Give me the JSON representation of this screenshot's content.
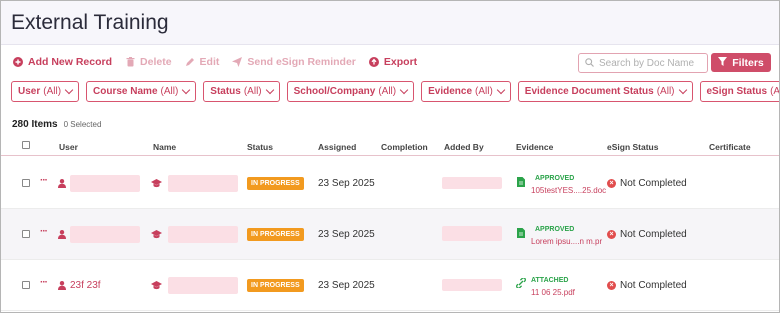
{
  "page": {
    "title": "External Training"
  },
  "toolbar": {
    "add_label": "Add New Record",
    "delete_label": "Delete",
    "edit_label": "Edit",
    "esign_label": "Send eSign Reminder",
    "export_label": "Export"
  },
  "search": {
    "placeholder": "Search by Doc Name"
  },
  "filters_button": {
    "label": "Filters"
  },
  "filter_chips": [
    {
      "label": "User",
      "value": "(All)"
    },
    {
      "label": "Course Name",
      "value": "(All)"
    },
    {
      "label": "Status",
      "value": "(All)"
    },
    {
      "label": "School/Company",
      "value": "(All)"
    },
    {
      "label": "Evidence",
      "value": "(All)"
    },
    {
      "label": "Evidence Document Status",
      "value": "(All)"
    },
    {
      "label": "eSign Status",
      "value": "(All)"
    }
  ],
  "summary": {
    "items": "280 Items",
    "selected": "0 Selected"
  },
  "table": {
    "columns": {
      "user": "User",
      "name": "Name",
      "status": "Status",
      "assigned": "Assigned",
      "completion": "Completion",
      "added_by": "Added By",
      "evidence": "Evidence",
      "esign_status": "eSign Status",
      "certificate": "Certificate"
    },
    "rows": [
      {
        "user": "",
        "status": "IN PROGRESS",
        "assigned": "23 Sep 2025",
        "evidence_label": "APPROVED",
        "evidence_file": "105testYES....25.doc",
        "esign": "Not Completed"
      },
      {
        "user": "",
        "status": "IN PROGRESS",
        "assigned": "23 Sep 2025",
        "evidence_label": "APPROVED",
        "evidence_file": "Lorem ipsu....n m.pr",
        "esign": "Not Completed"
      },
      {
        "user": "23f 23f",
        "status": "IN PROGRESS",
        "assigned": "23 Sep 2025",
        "evidence_label": "ATTACHED",
        "evidence_file": "11 06 25.pdf",
        "esign": "Not Completed"
      }
    ]
  },
  "colors": {
    "accent": "#cf4d69",
    "status_orange": "#f29a1f",
    "approved_green": "#2ba34a",
    "error_red": "#e14d4d"
  }
}
